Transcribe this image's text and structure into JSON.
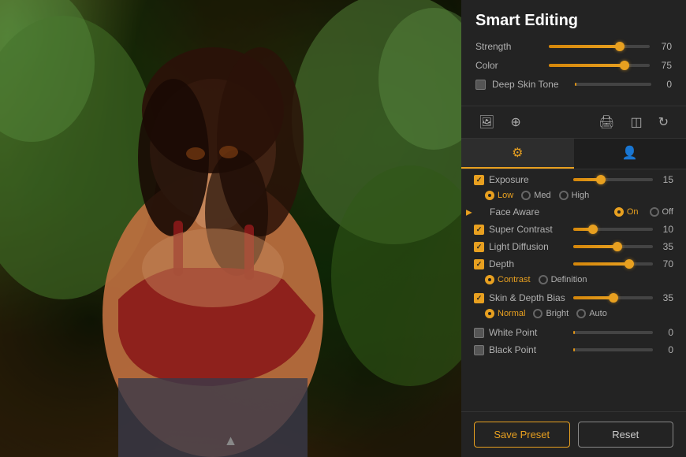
{
  "panel_title": "Smart Editing",
  "top_sliders": [
    {
      "label": "Strength",
      "value": 70,
      "percent": 70
    },
    {
      "label": "Color",
      "value": 75,
      "percent": 75
    }
  ],
  "deep_skin_tone": {
    "label": "Deep Skin Tone",
    "value": 0,
    "checked": false
  },
  "toolbar": {
    "icons": [
      "image",
      "crop",
      "print",
      "compare",
      "refresh"
    ]
  },
  "tabs": [
    {
      "label": "≡",
      "id": "sliders",
      "active": true
    },
    {
      "label": "⚈",
      "id": "person",
      "active": false
    }
  ],
  "exposure_row": {
    "label": "Exposure",
    "value": 15
  },
  "exposure_radios": [
    {
      "label": "Low",
      "active": true
    },
    {
      "label": "Med",
      "active": false
    },
    {
      "label": "High",
      "active": false
    }
  ],
  "face_aware": {
    "label": "Face Aware",
    "on_label": "On",
    "off_label": "Off",
    "active": "On"
  },
  "controls": [
    {
      "label": "Super Contrast",
      "value": 10,
      "percent": 25,
      "checked": true
    },
    {
      "label": "Light Diffusion",
      "value": 35,
      "percent": 55,
      "checked": true
    },
    {
      "label": "Depth",
      "value": 70,
      "percent": 70,
      "checked": true
    }
  ],
  "depth_radios": [
    {
      "label": "Contrast",
      "active": true
    },
    {
      "label": "Definition",
      "active": false
    }
  ],
  "skin_depth_bias": {
    "label": "Skin & Depth Bias",
    "value": 35,
    "percent": 50,
    "checked": true
  },
  "skin_depth_radios": [
    {
      "label": "Normal",
      "active": true
    },
    {
      "label": "Bright",
      "active": false
    },
    {
      "label": "Auto",
      "active": false
    }
  ],
  "white_point": {
    "label": "White Point",
    "value": 0,
    "checked": false
  },
  "black_point": {
    "label": "Black Point",
    "value": 0,
    "checked": false
  },
  "buttons": {
    "save_preset": "Save Preset",
    "reset": "Reset"
  }
}
